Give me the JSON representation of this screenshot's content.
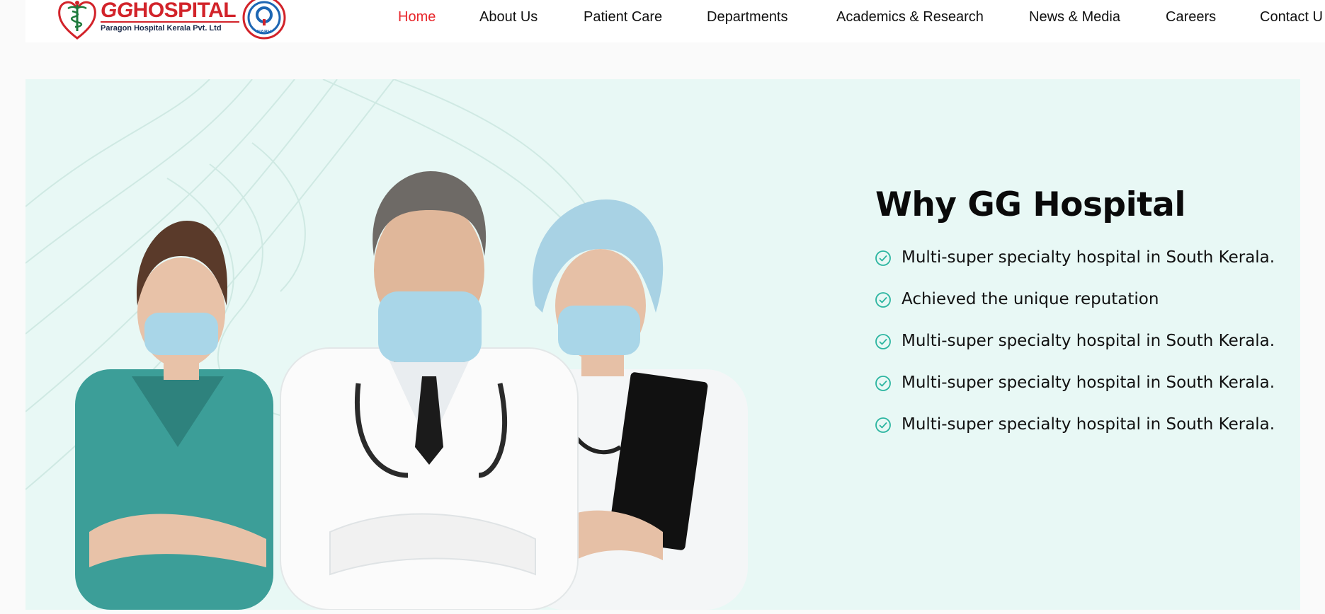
{
  "brand": {
    "name_prefix": "GG",
    "name_suffix": "HOSPITAL",
    "subtitle": "Paragon Hospital Kerala Pvt. Ltd",
    "accreditation_badge_text": "NABH",
    "brand_color": "#d2232a"
  },
  "nav": {
    "items": [
      {
        "label": "Home",
        "active": true
      },
      {
        "label": "About Us",
        "active": false
      },
      {
        "label": "Patient Care",
        "active": false
      },
      {
        "label": "Departments",
        "active": false
      },
      {
        "label": "Academics & Research",
        "active": false
      },
      {
        "label": "News & Media",
        "active": false
      },
      {
        "label": "Careers",
        "active": false
      },
      {
        "label": "Contact U",
        "active": false
      }
    ],
    "active_color": "#e8262b"
  },
  "why": {
    "title": "Why GG Hospital",
    "items": [
      "Multi-super specialty hospital in South Kerala.",
      "Achieved the unique reputation",
      "Multi-super specialty hospital in South Kerala.",
      "Multi-super specialty hospital in South Kerala.",
      "Multi-super specialty hospital in South Kerala."
    ],
    "check_color": "#2bb5a0",
    "background": "#e8f8f5"
  },
  "icons": {
    "logo": "caduceus-heart-icon",
    "badge": "nabh-badge-icon",
    "check": "check-circle-icon"
  }
}
